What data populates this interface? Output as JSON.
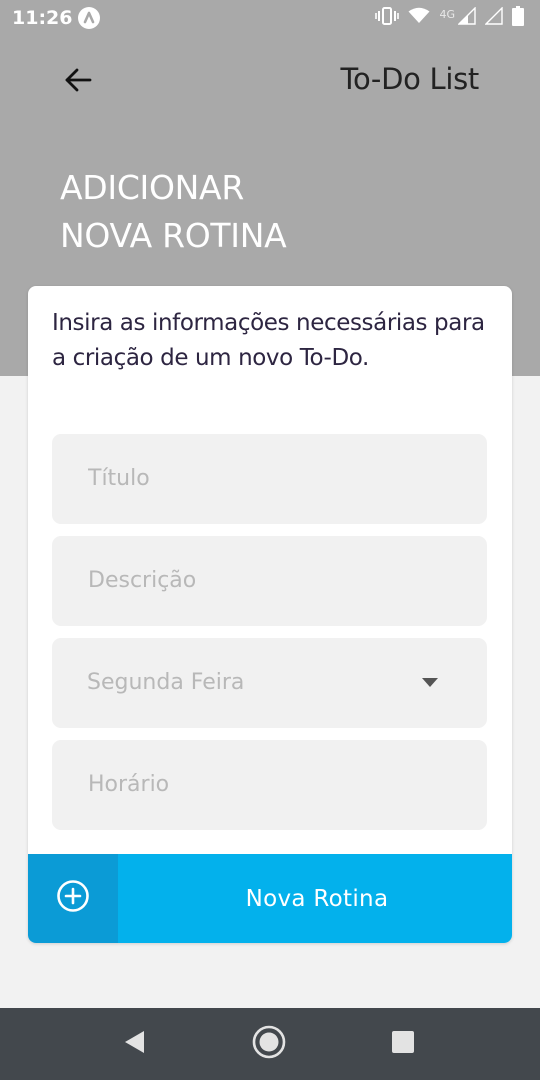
{
  "status_bar": {
    "time": "11:26",
    "network_label": "4G",
    "icons": [
      "app-notification-icon",
      "vibrate-icon",
      "wifi-icon",
      "signal-icon",
      "signal-empty-icon",
      "battery-icon"
    ]
  },
  "header": {
    "app_title": "To-Do List",
    "back_icon": "arrow-left-icon",
    "heading_line1": "ADICIONAR",
    "heading_line2": "NOVA ROTINA",
    "background_color": "#a9a9a9"
  },
  "form": {
    "intro_text": "Insira as informações necessárias para a criação de um novo To-Do.",
    "title_placeholder": "Título",
    "description_placeholder": "Descrição",
    "day_selected": "Segunda Feira",
    "time_placeholder": "Horário"
  },
  "submit": {
    "label": "Nova Rotina",
    "icon": "plus-circle-icon",
    "accent_color": "#03b1ec",
    "icon_bg_color": "#0b9bd6"
  },
  "nav_bar": {
    "icons": [
      "back-triangle-icon",
      "home-circle-icon",
      "recents-square-icon"
    ]
  }
}
